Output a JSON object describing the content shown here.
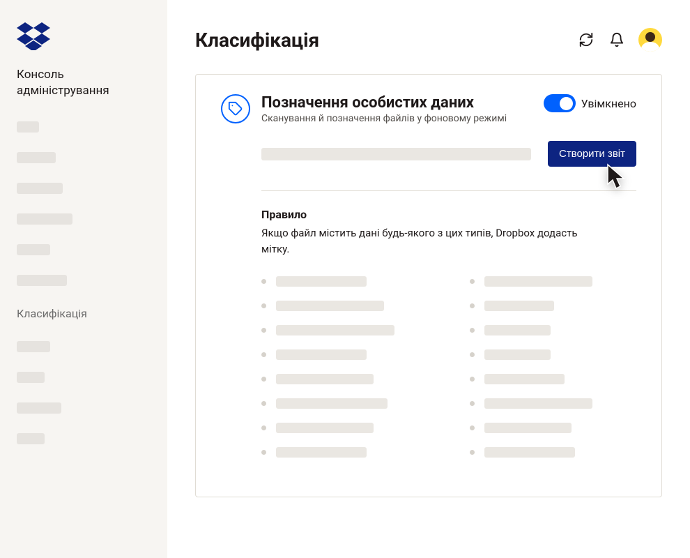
{
  "sidebar": {
    "title": "Консоль адміністрування",
    "active_item": "Класифікація"
  },
  "header": {
    "title": "Класифікація"
  },
  "card": {
    "title": "Позначення особистих даних",
    "subtitle": "Сканування й позначення файлів у фоновому режимі",
    "toggle_label": "Увімкнено",
    "report_button": "Створити звіт"
  },
  "rule": {
    "title": "Правило",
    "description": "Якщо файл містить дані будь-якого з цих типів, Dropbox додасть мітку."
  }
}
